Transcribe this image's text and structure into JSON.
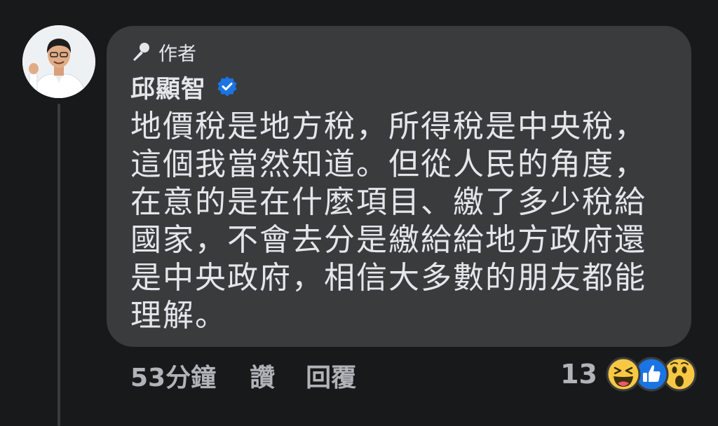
{
  "comment": {
    "author_badge": "作者",
    "author_name": "邱顯智",
    "verified": true,
    "text": "地價稅是地方稅，所得稅是中央稅，\n這個我當然知道。但從人民的角度，\n在意的是在什麼項目、繳了多少稅給\n國家，不會去分是繳給給地方政府還\n是中央政府，相信大多數的朋友都能\n理解。"
  },
  "meta": {
    "timestamp": "53分鐘",
    "like_label": "讚",
    "reply_label": "回覆"
  },
  "reactions": {
    "count": "13",
    "icons": [
      "laugh-reaction",
      "like-reaction",
      "wow-reaction"
    ]
  },
  "colors": {
    "background": "#18191a",
    "bubble": "#3a3b3c",
    "text": "#e4e6eb",
    "secondary_text": "#b0b3b8",
    "verified_blue": "#1b74e4"
  }
}
